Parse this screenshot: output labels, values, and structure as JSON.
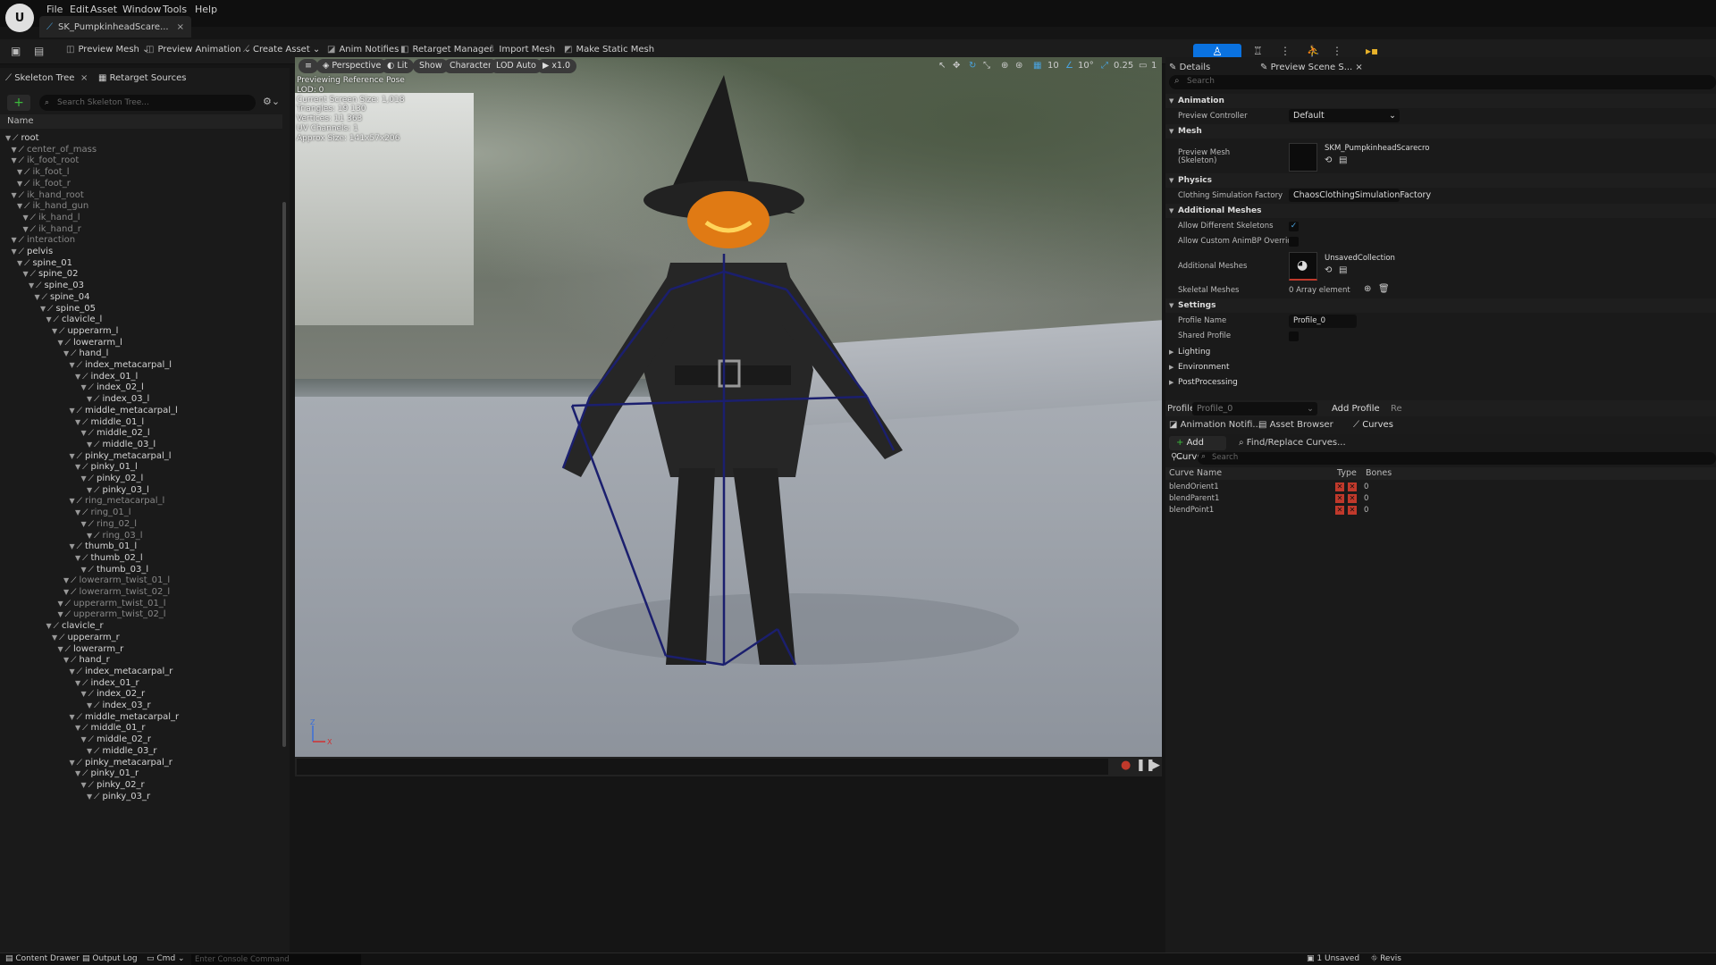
{
  "app": {
    "logo_text": "U",
    "asset_tab": "SK_PumpkinheadScare...",
    "close_glyph": "×"
  },
  "menu": [
    "File",
    "Edit",
    "Asset",
    "Window",
    "Tools",
    "Help"
  ],
  "toolbar": {
    "preview_mesh": "Preview Mesh",
    "preview_animation": "Preview Animation",
    "create_asset": "Create Asset",
    "anim_notifies": "Anim Notifies",
    "retarget_manager": "Retarget Manager",
    "import_mesh": "Import Mesh",
    "make_static_mesh": "Make Static Mesh"
  },
  "left_panel": {
    "tab1": "Skeleton Tree",
    "tab2": "Retarget Sources",
    "search_placeholder": "Search Skeleton Tree...",
    "name_header": "Name",
    "bones": [
      {
        "name": "root",
        "indent": 0,
        "dim": false
      },
      {
        "name": "center_of_mass",
        "indent": 1,
        "dim": true
      },
      {
        "name": "ik_foot_root",
        "indent": 1,
        "dim": true
      },
      {
        "name": "ik_foot_l",
        "indent": 2,
        "dim": true
      },
      {
        "name": "ik_foot_r",
        "indent": 2,
        "dim": true
      },
      {
        "name": "ik_hand_root",
        "indent": 1,
        "dim": true
      },
      {
        "name": "ik_hand_gun",
        "indent": 2,
        "dim": true
      },
      {
        "name": "ik_hand_l",
        "indent": 3,
        "dim": true
      },
      {
        "name": "ik_hand_r",
        "indent": 3,
        "dim": true
      },
      {
        "name": "interaction",
        "indent": 1,
        "dim": true
      },
      {
        "name": "pelvis",
        "indent": 1,
        "dim": false
      },
      {
        "name": "spine_01",
        "indent": 2,
        "dim": false
      },
      {
        "name": "spine_02",
        "indent": 3,
        "dim": false
      },
      {
        "name": "spine_03",
        "indent": 4,
        "dim": false
      },
      {
        "name": "spine_04",
        "indent": 5,
        "dim": false
      },
      {
        "name": "spine_05",
        "indent": 6,
        "dim": false
      },
      {
        "name": "clavicle_l",
        "indent": 7,
        "dim": false
      },
      {
        "name": "upperarm_l",
        "indent": 8,
        "dim": false
      },
      {
        "name": "lowerarm_l",
        "indent": 9,
        "dim": false
      },
      {
        "name": "hand_l",
        "indent": 10,
        "dim": false
      },
      {
        "name": "index_metacarpal_l",
        "indent": 11,
        "dim": false
      },
      {
        "name": "index_01_l",
        "indent": 12,
        "dim": false
      },
      {
        "name": "index_02_l",
        "indent": 13,
        "dim": false
      },
      {
        "name": "index_03_l",
        "indent": 14,
        "dim": false
      },
      {
        "name": "middle_metacarpal_l",
        "indent": 11,
        "dim": false
      },
      {
        "name": "middle_01_l",
        "indent": 12,
        "dim": false
      },
      {
        "name": "middle_02_l",
        "indent": 13,
        "dim": false
      },
      {
        "name": "middle_03_l",
        "indent": 14,
        "dim": false
      },
      {
        "name": "pinky_metacarpal_l",
        "indent": 11,
        "dim": false
      },
      {
        "name": "pinky_01_l",
        "indent": 12,
        "dim": false
      },
      {
        "name": "pinky_02_l",
        "indent": 13,
        "dim": false
      },
      {
        "name": "pinky_03_l",
        "indent": 14,
        "dim": false
      },
      {
        "name": "ring_metacarpal_l",
        "indent": 11,
        "dim": true
      },
      {
        "name": "ring_01_l",
        "indent": 12,
        "dim": true
      },
      {
        "name": "ring_02_l",
        "indent": 13,
        "dim": true
      },
      {
        "name": "ring_03_l",
        "indent": 14,
        "dim": true
      },
      {
        "name": "thumb_01_l",
        "indent": 11,
        "dim": false
      },
      {
        "name": "thumb_02_l",
        "indent": 12,
        "dim": false
      },
      {
        "name": "thumb_03_l",
        "indent": 13,
        "dim": false
      },
      {
        "name": "lowerarm_twist_01_l",
        "indent": 10,
        "dim": true
      },
      {
        "name": "lowerarm_twist_02_l",
        "indent": 10,
        "dim": true
      },
      {
        "name": "upperarm_twist_01_l",
        "indent": 9,
        "dim": true
      },
      {
        "name": "upperarm_twist_02_l",
        "indent": 9,
        "dim": true
      },
      {
        "name": "clavicle_r",
        "indent": 7,
        "dim": false
      },
      {
        "name": "upperarm_r",
        "indent": 8,
        "dim": false
      },
      {
        "name": "lowerarm_r",
        "indent": 9,
        "dim": false
      },
      {
        "name": "hand_r",
        "indent": 10,
        "dim": false
      },
      {
        "name": "index_metacarpal_r",
        "indent": 11,
        "dim": false
      },
      {
        "name": "index_01_r",
        "indent": 12,
        "dim": false
      },
      {
        "name": "index_02_r",
        "indent": 13,
        "dim": false
      },
      {
        "name": "index_03_r",
        "indent": 14,
        "dim": false
      },
      {
        "name": "middle_metacarpal_r",
        "indent": 11,
        "dim": false
      },
      {
        "name": "middle_01_r",
        "indent": 12,
        "dim": false
      },
      {
        "name": "middle_02_r",
        "indent": 13,
        "dim": false
      },
      {
        "name": "middle_03_r",
        "indent": 14,
        "dim": false
      },
      {
        "name": "pinky_metacarpal_r",
        "indent": 11,
        "dim": false
      },
      {
        "name": "pinky_01_r",
        "indent": 12,
        "dim": false
      },
      {
        "name": "pinky_02_r",
        "indent": 13,
        "dim": false
      },
      {
        "name": "pinky_03_r",
        "indent": 14,
        "dim": false
      }
    ]
  },
  "viewport": {
    "perspective": "Perspective",
    "lit": "Lit",
    "show": "Show",
    "character": "Character",
    "lod": "LOD Auto",
    "speed": "x1.0",
    "grid_value": "10",
    "angle_value": "10°",
    "scale_value": "0.25",
    "camera_speed": "1",
    "stats": [
      "Previewing Reference Pose",
      "LOD: 0",
      "Current Screen Size: 1,018",
      "Triangles: 19 130",
      "Vertices: 11 363",
      "UV Channels: 1",
      "Approx Size: 141x57x206"
    ],
    "axis_z": "Z",
    "axis_x": "X"
  },
  "right_panel": {
    "tab_details": "Details",
    "tab_preview": "Preview Scene S...",
    "search_placeholder": "Search",
    "sections": {
      "animation": "Animation",
      "preview_controller_label": "Preview Controller",
      "preview_controller_value": "Default",
      "mesh": "Mesh",
      "preview_mesh_label": "Preview Mesh",
      "preview_mesh_sub": "(Skeleton)",
      "preview_mesh_value": "SKM_PumpkinheadScarecro",
      "physics": "Physics",
      "clothing_label": "Clothing Simulation Factory",
      "clothing_value": "ChaosClothingSimulationFactory",
      "additional_meshes": "Additional Meshes",
      "allow_diff_skel": "Allow Different Skeletons",
      "allow_custom": "Allow Custom AnimBP Override",
      "additional_meshes_label": "Additional Meshes",
      "unsaved": "UnsavedCollection",
      "skeletal_meshes": "Skeletal Meshes",
      "array": "0 Array element",
      "settings": "Settings",
      "profile_name": "Profile Name",
      "profile_value": "Profile_0",
      "shared_profile": "Shared Profile",
      "lighting": "Lighting",
      "environment": "Environment",
      "postprocessing": "PostProcessing"
    },
    "profile_label": "Profile",
    "profile_select": "Profile_0",
    "add_profile": "Add Profile",
    "re": "Re",
    "tabs": [
      "Animation Notifi...",
      "Asset Browser",
      "Curves"
    ],
    "add_curve": "Add Curve",
    "find_replace": "Find/Replace Curves...",
    "curve_search": "Search",
    "curve_headers": [
      "Curve Name",
      "Type",
      "Bones"
    ],
    "curves": [
      {
        "name": "blendOrient1",
        "bones": "0"
      },
      {
        "name": "blendParent1",
        "bones": "0"
      },
      {
        "name": "blendPoint1",
        "bones": "0"
      }
    ]
  },
  "bottom": {
    "content_drawer": "Content Drawer",
    "output_log": "Output Log",
    "cmd": "Cmd",
    "console_placeholder": "Enter Console Command",
    "unsaved": "1 Unsaved",
    "revision": "Revis"
  },
  "colors": {
    "accent": "#0a72e0",
    "bone": "#1b1f6e",
    "curve_badge": "#c0392b"
  }
}
